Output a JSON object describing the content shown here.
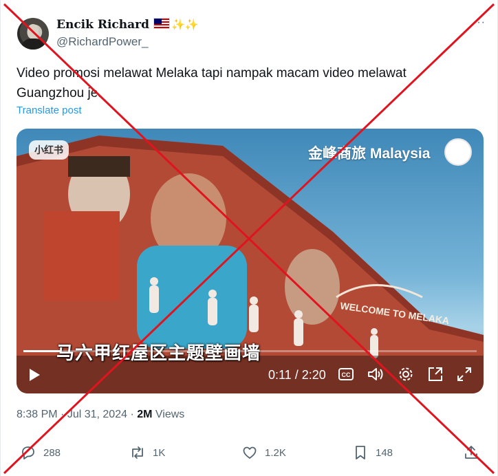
{
  "author": {
    "display_name": "Encik Richard",
    "emoji": "✨✨",
    "handle": "@RichardPower_",
    "more_label": "···"
  },
  "tweet": {
    "text": "Video promosi melawat Melaka tapi nampak macam video melawat Guangzhou je.",
    "translate_label": "Translate post"
  },
  "video": {
    "watermark_app": "小红书",
    "brand_text": "金峰商旅 Malaysia",
    "wall_sign": "WELCOME TO MELAKA",
    "caption": "马六甲红屋区主题壁画墙",
    "current_time": "0:11",
    "duration": "2:20",
    "time_display": "0:11 / 2:20",
    "progress": 0.08
  },
  "meta": {
    "time": "8:38 PM",
    "date": "Jul 31, 2024",
    "views_count": "2M",
    "views_label": "Views"
  },
  "actions": {
    "replies": "288",
    "reposts": "1K",
    "likes": "1.2K",
    "bookmarks": "148"
  },
  "colors": {
    "accent": "#1d9bf0",
    "muted": "#536471",
    "cross": "#e0141e"
  }
}
